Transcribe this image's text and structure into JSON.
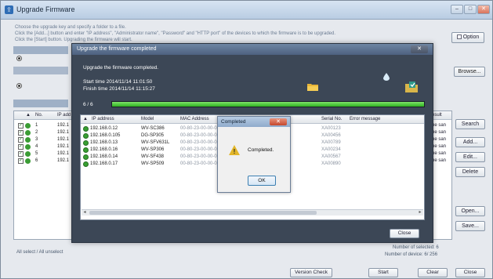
{
  "window": {
    "title": "Upgrade Firmware",
    "icon": "upgrade-icon",
    "controls": {
      "minimize": "–",
      "maximize": "□",
      "close": "✕"
    }
  },
  "instructions": {
    "line1": "Choose the upgrade key and specify a folder to a file.",
    "line2": "Click the [Add...] button and enter \"IP address\", \"Administrator name\", \"Password\" and \"HTTP port\" of the devices to which the firmware is to be upgraded.",
    "line3": "Click the [Start] button. Upgrading the firmware will start."
  },
  "option_button": "Option",
  "browse_button": "Browse...",
  "side_buttons": {
    "search": "Search",
    "add": "Add...",
    "edit": "Edit...",
    "delete": "Delete",
    "open": "Open...",
    "save": "Save..."
  },
  "bg_table": {
    "headers": {
      "no": "No.",
      "ip": "IP add",
      "result": "esult"
    },
    "rows": [
      {
        "no": "1",
        "ip": "192.1",
        "result": "he san"
      },
      {
        "no": "2",
        "ip": "192.1",
        "result": "he san"
      },
      {
        "no": "3",
        "ip": "192.1",
        "result": "he san"
      },
      {
        "no": "4",
        "ip": "192.1",
        "result": "he san"
      },
      {
        "no": "5",
        "ip": "192.1",
        "result": "he san"
      },
      {
        "no": "6",
        "ip": "192.1",
        "result": "he san"
      }
    ]
  },
  "footer": {
    "select_all": "All select / All unselect",
    "selected": "Number of selected: 6",
    "devices": "Number of device: 6/ 256"
  },
  "bottom_buttons": {
    "version_check": "Version Check",
    "start": "Start",
    "clear": "Clear",
    "close": "Close"
  },
  "dialog": {
    "title": "Upgrade the firmware completed",
    "close_x": "✕",
    "message": "Upgrade the firmware completed.",
    "start_time": "Start time 2014/11/14 11:01:50",
    "finish_time": "Finish time 2014/11/14 11:15:27",
    "progress_label": "6 / 6",
    "progress_fraction": 1.0,
    "progress_color": "#2fb320",
    "columns": {
      "ip": "IP address",
      "model": "Model",
      "mac": "MAC Address",
      "serial": "Serial No.",
      "error": "Error message"
    },
    "rows": [
      {
        "ip": "192.168.0.12",
        "model": "WV-SC386",
        "mac": "00-80-23-00-00-00",
        "serial": "XA00123"
      },
      {
        "ip": "192.168.0.105",
        "model": "DG-SP305",
        "mac": "00-80-23-00-00-00",
        "serial": "XA00456"
      },
      {
        "ip": "192.168.0.13",
        "model": "WV-SFV631L",
        "mac": "00-80-23-00-00-00",
        "serial": "XA00789"
      },
      {
        "ip": "192.168.0.16",
        "model": "WV-SP306",
        "mac": "00-80-23-00-00-00",
        "serial": "XA00234"
      },
      {
        "ip": "192.168.0.14",
        "model": "WV-SF438",
        "mac": "00-80-23-00-00-00",
        "serial": "XA00567"
      },
      {
        "ip": "192.168.0.17",
        "model": "WV-SP509",
        "mac": "00-80-23-00-00-00",
        "serial": "XA00890"
      }
    ],
    "close_button": "Close"
  },
  "popup": {
    "title": "Completed",
    "close_x": "✕",
    "message": "Completed.",
    "ok_button": "OK",
    "icon": "warning-icon"
  }
}
